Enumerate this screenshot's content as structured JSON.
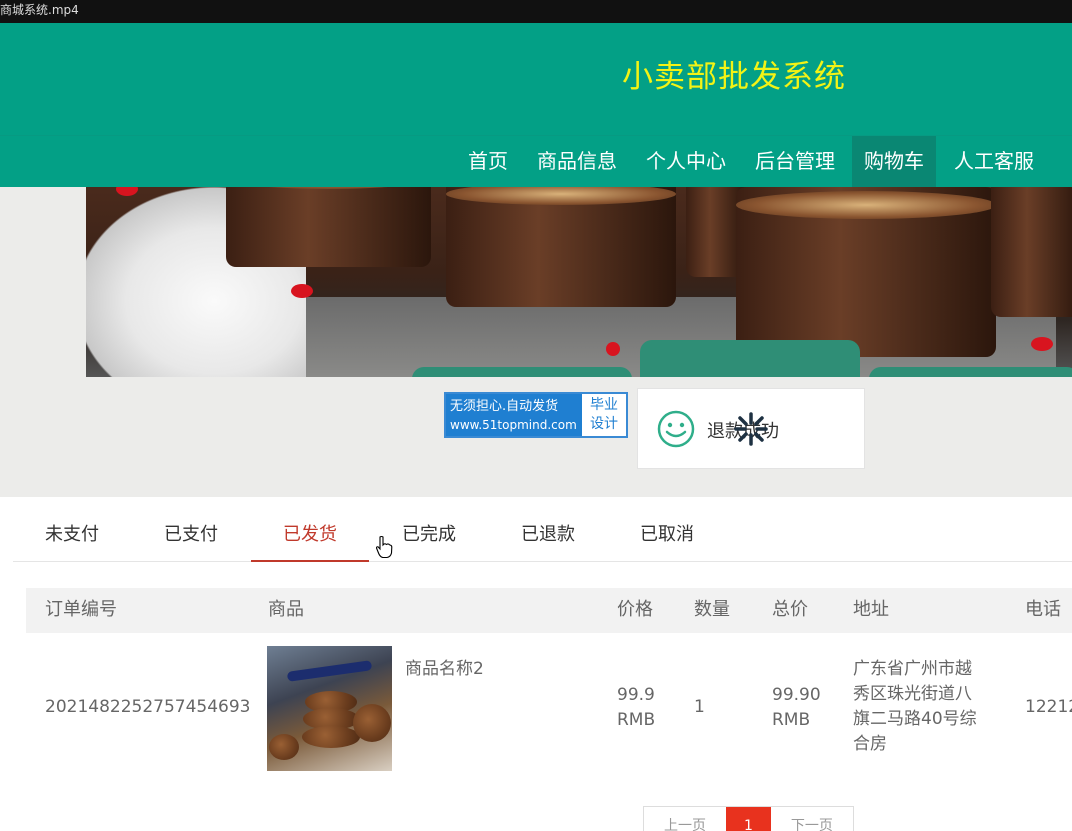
{
  "titlebar": {
    "text": "商城系统.mp4"
  },
  "site": {
    "title": "小卖部批发系统"
  },
  "nav": [
    {
      "label": "首页",
      "active": false
    },
    {
      "label": "商品信息",
      "active": false
    },
    {
      "label": "个人中心",
      "active": false
    },
    {
      "label": "后台管理",
      "active": false
    },
    {
      "label": "购物车",
      "active": true
    },
    {
      "label": "人工客服",
      "active": false
    }
  ],
  "ad": {
    "line1": "无须担心.自动发货",
    "line2": "www.51topmind.com",
    "right_top": "毕业",
    "right_bottom": "设计"
  },
  "toast": {
    "message": "退款成功",
    "icon": "smile-icon"
  },
  "order_tabs": [
    {
      "label": "未支付",
      "active": false
    },
    {
      "label": "已支付",
      "active": false
    },
    {
      "label": "已发货",
      "active": true
    },
    {
      "label": "已完成",
      "active": false
    },
    {
      "label": "已退款",
      "active": false
    },
    {
      "label": "已取消",
      "active": false
    }
  ],
  "table": {
    "headers": [
      "订单编号",
      "商品",
      "价格",
      "数量",
      "总价",
      "地址",
      "电话"
    ],
    "rows": [
      {
        "order_no": "2021482252757454693",
        "product_name": "商品名称2",
        "price_value": "99.9",
        "price_unit": "RMB",
        "quantity": "1",
        "total_value": "99.90",
        "total_unit": "RMB",
        "address_lines": [
          "广东省广州市越",
          "秀区珠光街道八",
          "旗二马路40号综",
          "合房"
        ],
        "phone": "12212"
      }
    ]
  },
  "pager": {
    "prev": "上一页",
    "current": "1",
    "next": "下一页"
  },
  "colors": {
    "header": "#03a086",
    "nav_active": "#0a8773",
    "title": "#f3f315",
    "tab_active": "#c0392b",
    "page_current": "#e8321e"
  }
}
